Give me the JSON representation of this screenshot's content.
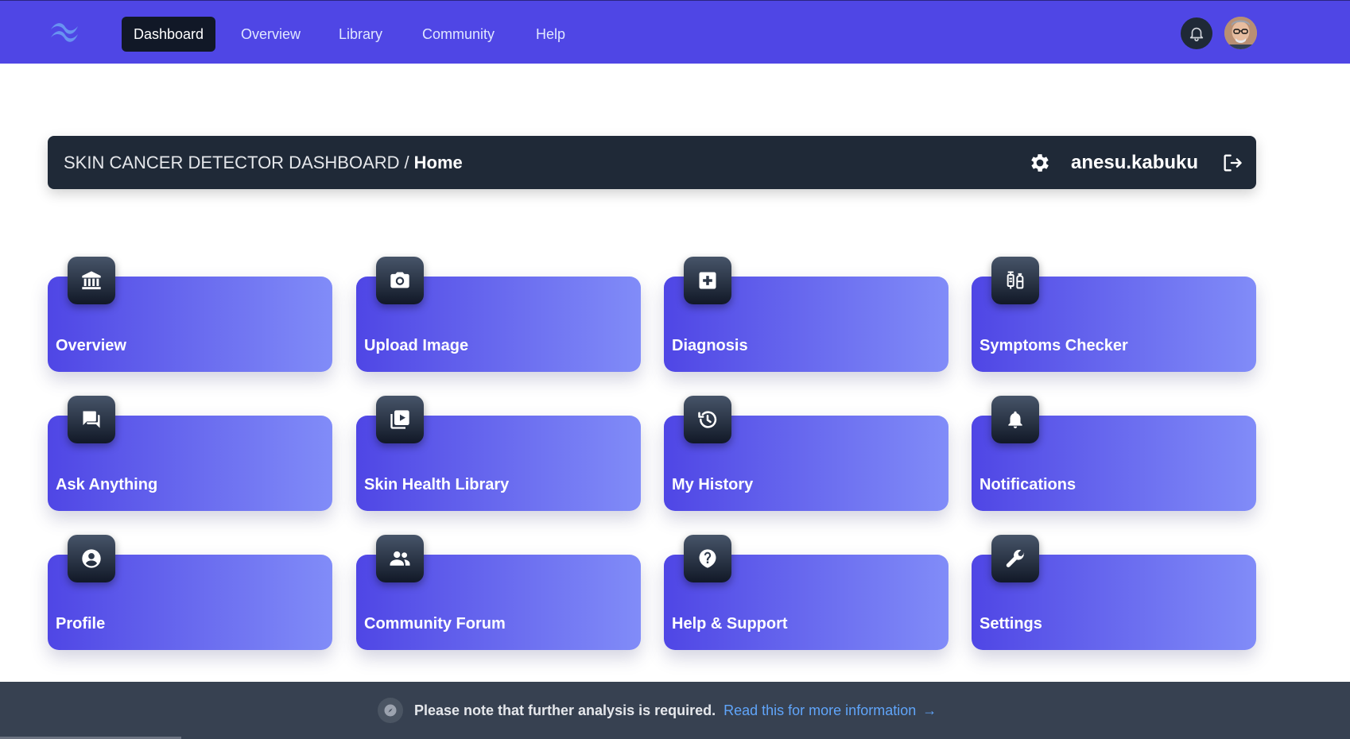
{
  "nav": {
    "items": [
      {
        "label": "Dashboard",
        "active": true
      },
      {
        "label": "Overview",
        "active": false
      },
      {
        "label": "Library",
        "active": false
      },
      {
        "label": "Community",
        "active": false
      },
      {
        "label": "Help",
        "active": false
      }
    ]
  },
  "header": {
    "app_name": "SKIN CANCER DETECTOR DASHBOARD",
    "separator": "/",
    "current_page": "Home",
    "username": "anesu.kabuku"
  },
  "cards": [
    {
      "label": "Overview",
      "icon": "bank-icon"
    },
    {
      "label": "Upload Image",
      "icon": "camera-icon"
    },
    {
      "label": "Diagnosis",
      "icon": "medical-plus-icon"
    },
    {
      "label": "Symptoms Checker",
      "icon": "vaccine-icon"
    },
    {
      "label": "Ask Anything",
      "icon": "chat-icon"
    },
    {
      "label": "Skin Health Library",
      "icon": "video-library-icon"
    },
    {
      "label": "My History",
      "icon": "history-icon"
    },
    {
      "label": "Notifications",
      "icon": "bell-icon"
    },
    {
      "label": "Profile",
      "icon": "user-circle-icon"
    },
    {
      "label": "Community Forum",
      "icon": "people-icon"
    },
    {
      "label": "Help & Support",
      "icon": "help-icon"
    },
    {
      "label": "Settings",
      "icon": "wrench-icon"
    }
  ],
  "banner": {
    "message": "Please note that further analysis is required.",
    "link_text": "Read this for more information",
    "link_arrow": "→"
  },
  "colors": {
    "nav_bg": "#4f46e5",
    "header_bg": "#1f2937",
    "card_gradient_start": "#4f46e5",
    "card_gradient_end": "#818cf8",
    "banner_bg": "#374151",
    "link": "#60a5fa"
  }
}
